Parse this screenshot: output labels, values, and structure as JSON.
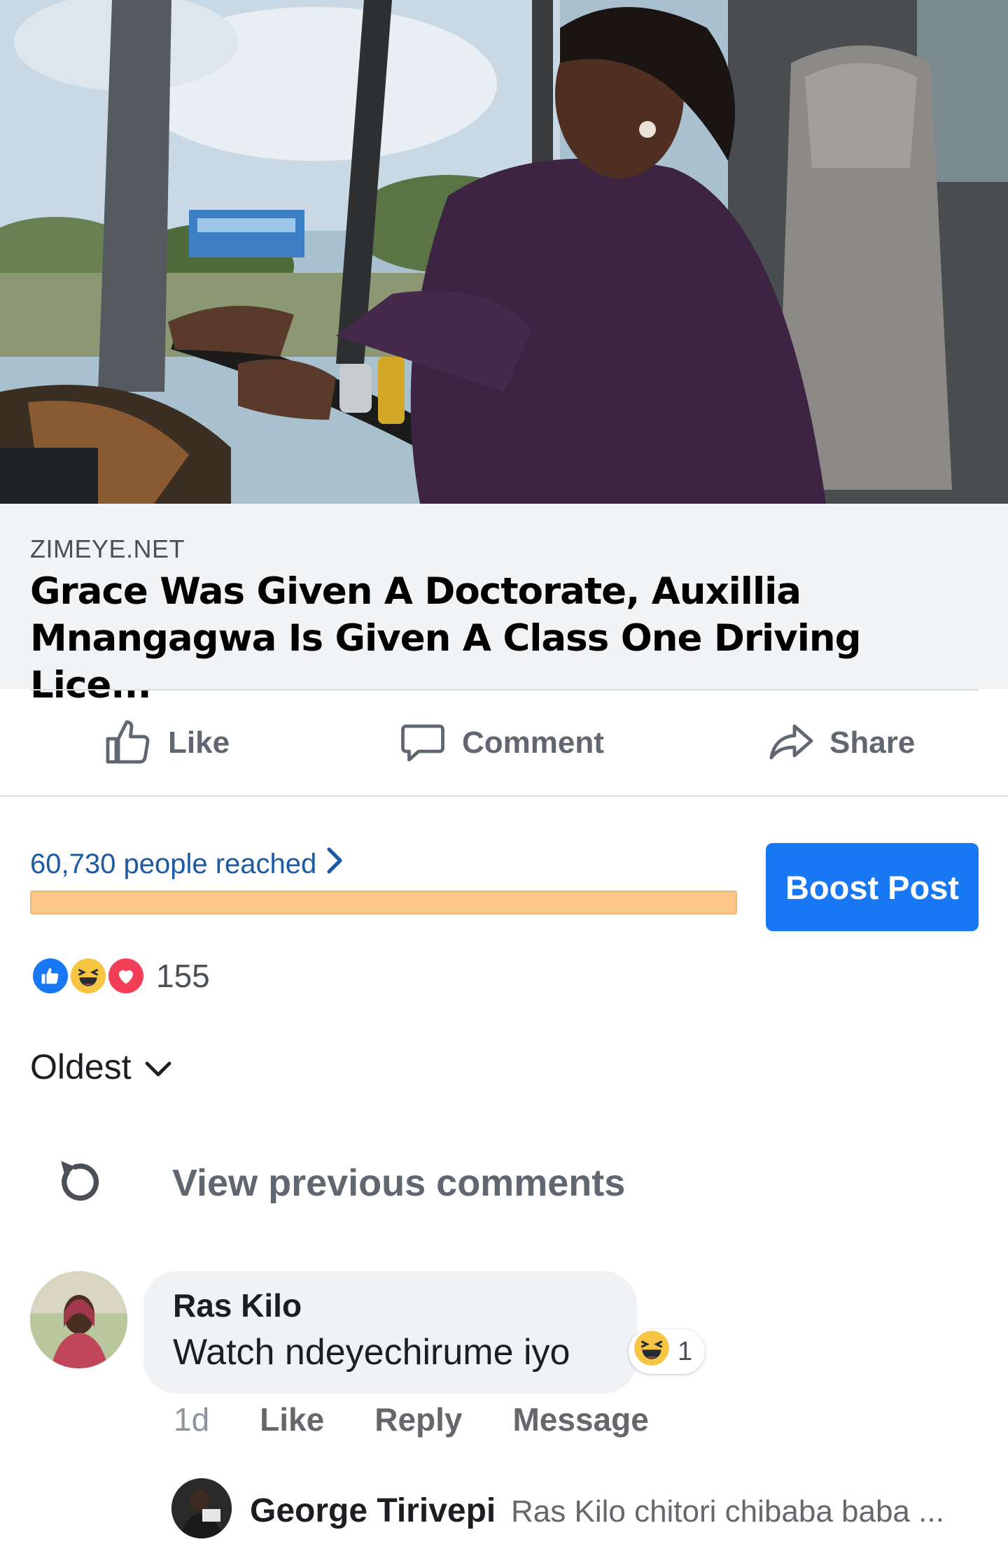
{
  "link": {
    "domain": "ZIMEYE.NET",
    "title": "Grace Was Given A Doctorate, Auxillia Mnangagwa Is Given A Class One Driving Lice..."
  },
  "actions": {
    "like": "Like",
    "comment": "Comment",
    "share": "Share"
  },
  "reach": {
    "text": "60,730 people reached",
    "progress": 1.0
  },
  "boost": {
    "label": "Boost Post",
    "color": "#1877f2"
  },
  "reactions": {
    "icons": [
      "like-icon",
      "haha-icon",
      "love-icon"
    ],
    "count": "155"
  },
  "sort": {
    "label": "Oldest"
  },
  "comments": {
    "view_previous": "View previous comments",
    "items": [
      {
        "name": "Ras Kilo",
        "text": "Watch ndeyechirume iyo",
        "reaction_count": "1",
        "time": "1d",
        "like": "Like",
        "reply": "Reply",
        "message": "Message"
      }
    ],
    "reply_preview": {
      "name": "George Tirivepi",
      "text": "Ras Kilo chitori chibaba baba ..."
    }
  }
}
